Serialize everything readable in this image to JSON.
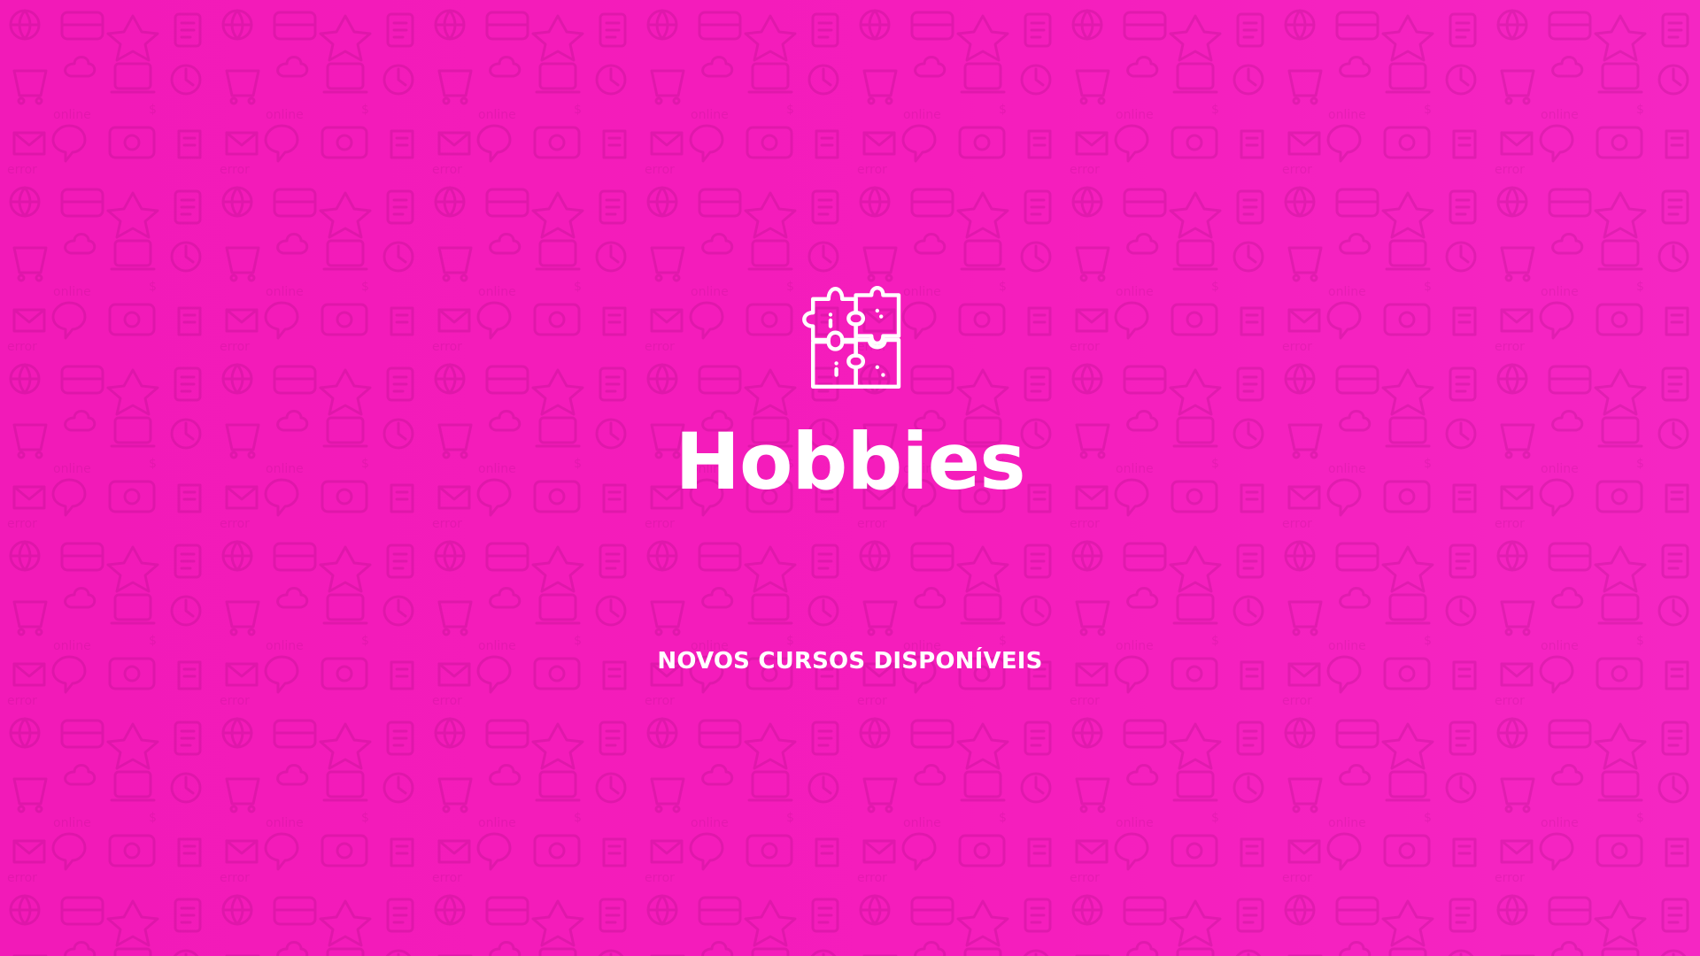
{
  "slide": {
    "title": "Hobbies",
    "subtitle": "NOVOS CURSOS DISPONÍVEIS",
    "main_icon": "puzzle-icon",
    "background_color": "#f21ab8",
    "text_color": "#ffffff",
    "background_pattern": "doodle-icons"
  }
}
